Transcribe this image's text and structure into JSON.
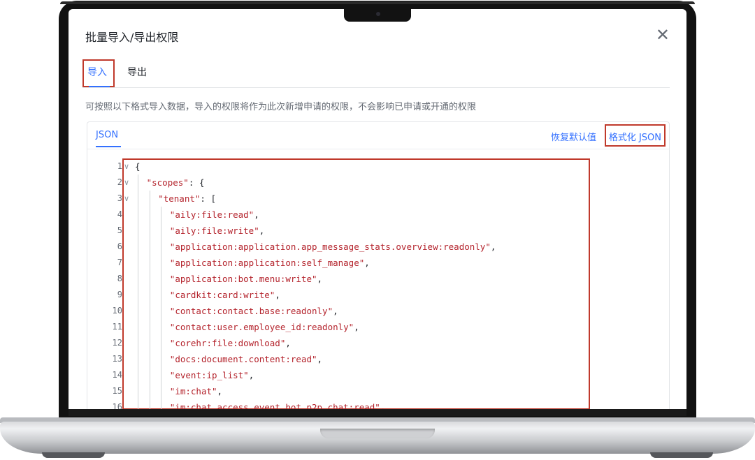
{
  "dialog": {
    "title": "批量导入/导出权限",
    "close_icon": "✕",
    "tabs": [
      {
        "label": "导入",
        "active": true
      },
      {
        "label": "导出",
        "active": false
      }
    ],
    "description": "可按照以下格式导入数据，导入的权限将作为此次新增申请的权限，不会影响已申请或开通的权限"
  },
  "editor": {
    "tab_label": "JSON",
    "reset_label": "恢复默认值",
    "format_label": "格式化 JSON",
    "lines": [
      {
        "n": "1",
        "fold": true,
        "text": "{"
      },
      {
        "n": "2",
        "fold": true,
        "text": "\"scopes\": {"
      },
      {
        "n": "3",
        "fold": true,
        "text": "\"tenant\": ["
      },
      {
        "n": "4",
        "fold": false,
        "text": "\"aily:file:read\","
      },
      {
        "n": "5",
        "fold": false,
        "text": "\"aily:file:write\","
      },
      {
        "n": "6",
        "fold": false,
        "text": "\"application:application.app_message_stats.overview:readonly\","
      },
      {
        "n": "7",
        "fold": false,
        "text": "\"application:application:self_manage\","
      },
      {
        "n": "8",
        "fold": false,
        "text": "\"application:bot.menu:write\","
      },
      {
        "n": "9",
        "fold": false,
        "text": "\"cardkit:card:write\","
      },
      {
        "n": "10",
        "fold": false,
        "text": "\"contact:contact.base:readonly\","
      },
      {
        "n": "11",
        "fold": false,
        "text": "\"contact:user.employee_id:readonly\","
      },
      {
        "n": "12",
        "fold": false,
        "text": "\"corehr:file:download\","
      },
      {
        "n": "13",
        "fold": false,
        "text": "\"docs:document.content:read\","
      },
      {
        "n": "14",
        "fold": false,
        "text": "\"event:ip_list\","
      },
      {
        "n": "15",
        "fold": false,
        "text": "\"im:chat\","
      },
      {
        "n": "16",
        "fold": false,
        "text": "\"im:chat.access_event.bot_p2p_chat:read\","
      }
    ]
  },
  "colors": {
    "accent": "#3370ff",
    "highlight_box": "#c0392b",
    "string": "#b4232c"
  }
}
